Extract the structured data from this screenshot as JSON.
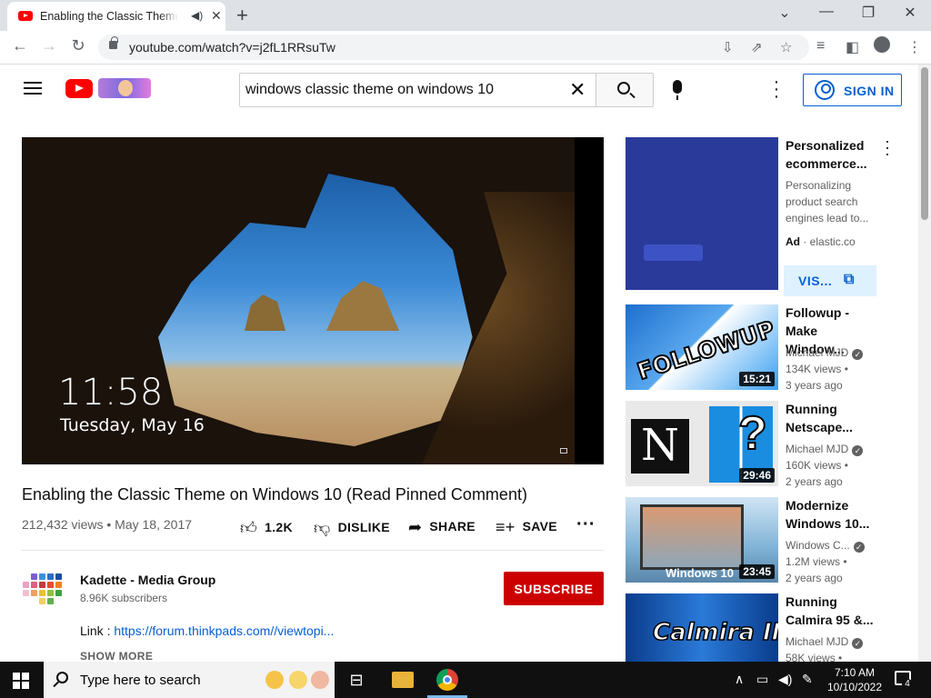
{
  "browser": {
    "tab_title": "Enabling the Classic Theme o",
    "url": "youtube.com/watch?v=j2fL1RRsuTw"
  },
  "masthead": {
    "search_query": "windows classic theme on windows 10",
    "signin_label": "SIGN IN"
  },
  "player": {
    "clock": "11:58",
    "date": "Tuesday, May 16"
  },
  "video": {
    "title": "Enabling the Classic Theme on Windows 10 (Read Pinned Comment)",
    "meta": "212,432 views • May 18, 2017",
    "likes": "1.2K",
    "dislike_label": "DISLIKE",
    "share_label": "SHARE",
    "save_label": "SAVE"
  },
  "channel": {
    "name": "Kadette - Media Group",
    "subscribers": "8.96K subscribers",
    "subscribe_label": "SUBSCRIBE"
  },
  "description": {
    "link_prefix": "Link : ",
    "link_text": "https://forum.thinkpads.com//viewtopi...",
    "show_more": "SHOW MORE"
  },
  "ad": {
    "title_line1": "Personalized",
    "title_line2": "ecommerce...",
    "desc_line1": "Personalizing",
    "desc_line2": "product search",
    "desc_line3": "engines lead to...",
    "ad_label": "Ad",
    "domain": "· elastic.co",
    "visit_label": "VIS..."
  },
  "recommendations": [
    {
      "title_line1": "Followup -",
      "title_line2": "Make Window...",
      "channel": "Michael MJD",
      "views": "134K views •",
      "age": "3 years ago",
      "duration": "15:21",
      "thumb_text": "FOLLOWUP"
    },
    {
      "title_line1": "Running",
      "title_line2": "Netscape...",
      "channel": "Michael MJD",
      "views": "160K views •",
      "age": "2 years ago",
      "duration": "29:46",
      "thumb_text": "N"
    },
    {
      "title_line1": "Modernize",
      "title_line2": "Windows 10...",
      "channel": "Windows C...",
      "views": "1.2M views •",
      "age": "2 years ago",
      "duration": "23:45",
      "thumb_text": "Windows 10"
    },
    {
      "title_line1": "Running",
      "title_line2": "Calmira 95 &...",
      "channel": "Michael MJD",
      "views": "58K views •",
      "age": "",
      "duration": "",
      "thumb_text": "Calmira II"
    }
  ],
  "taskbar": {
    "search_placeholder": "Type here to search",
    "time": "7:10 AM",
    "date": "10/10/2022",
    "notification_count": "4"
  }
}
